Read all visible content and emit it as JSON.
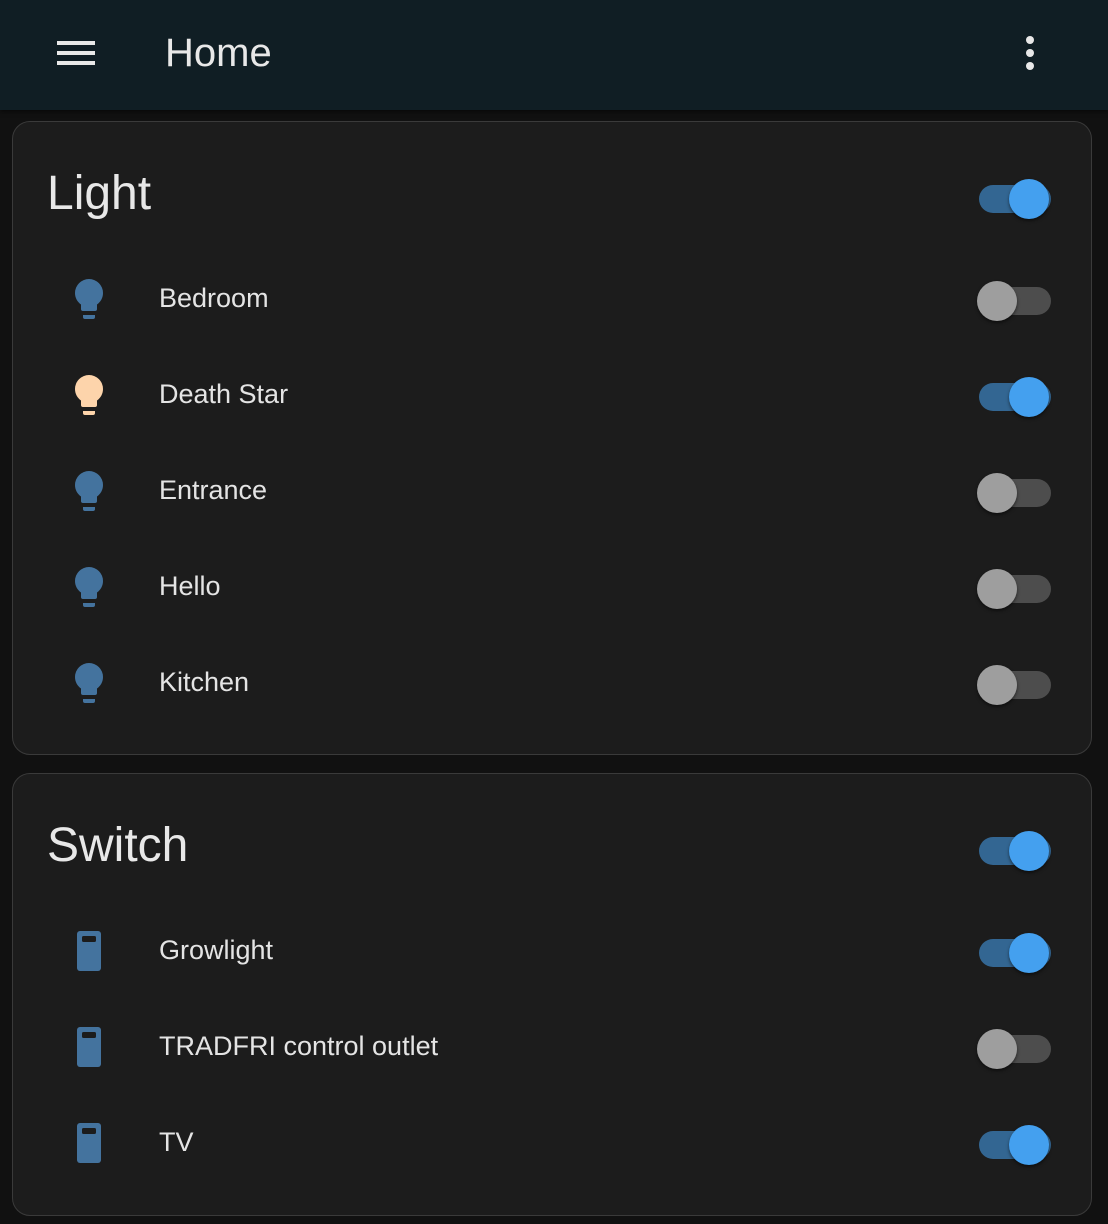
{
  "app_bar": {
    "title": "Home",
    "menu_icon": "hamburger-menu-icon",
    "more_icon": "more-vertical-icon",
    "background": "#101e24"
  },
  "colors": {
    "accent": "#44a0ef",
    "icon_off": "#44739e",
    "icon_on": "#fdd4ab",
    "card_background": "#1c1c1c"
  },
  "cards": [
    {
      "title": "Light",
      "all_on": true,
      "entities": [
        {
          "name": "Bedroom",
          "icon": "lightbulb-icon",
          "state": "off"
        },
        {
          "name": "Death Star",
          "icon": "lightbulb-icon",
          "state": "on"
        },
        {
          "name": "Entrance",
          "icon": "lightbulb-icon",
          "state": "off"
        },
        {
          "name": "Hello",
          "icon": "lightbulb-icon",
          "state": "off"
        },
        {
          "name": "Kitchen",
          "icon": "lightbulb-icon",
          "state": "off"
        }
      ]
    },
    {
      "title": "Switch",
      "all_on": true,
      "entities": [
        {
          "name": "Growlight",
          "icon": "switch-outlet-icon",
          "state": "on"
        },
        {
          "name": "TRADFRI control outlet",
          "icon": "switch-outlet-icon",
          "state": "off"
        },
        {
          "name": "TV",
          "icon": "switch-outlet-icon",
          "state": "on"
        }
      ]
    }
  ]
}
